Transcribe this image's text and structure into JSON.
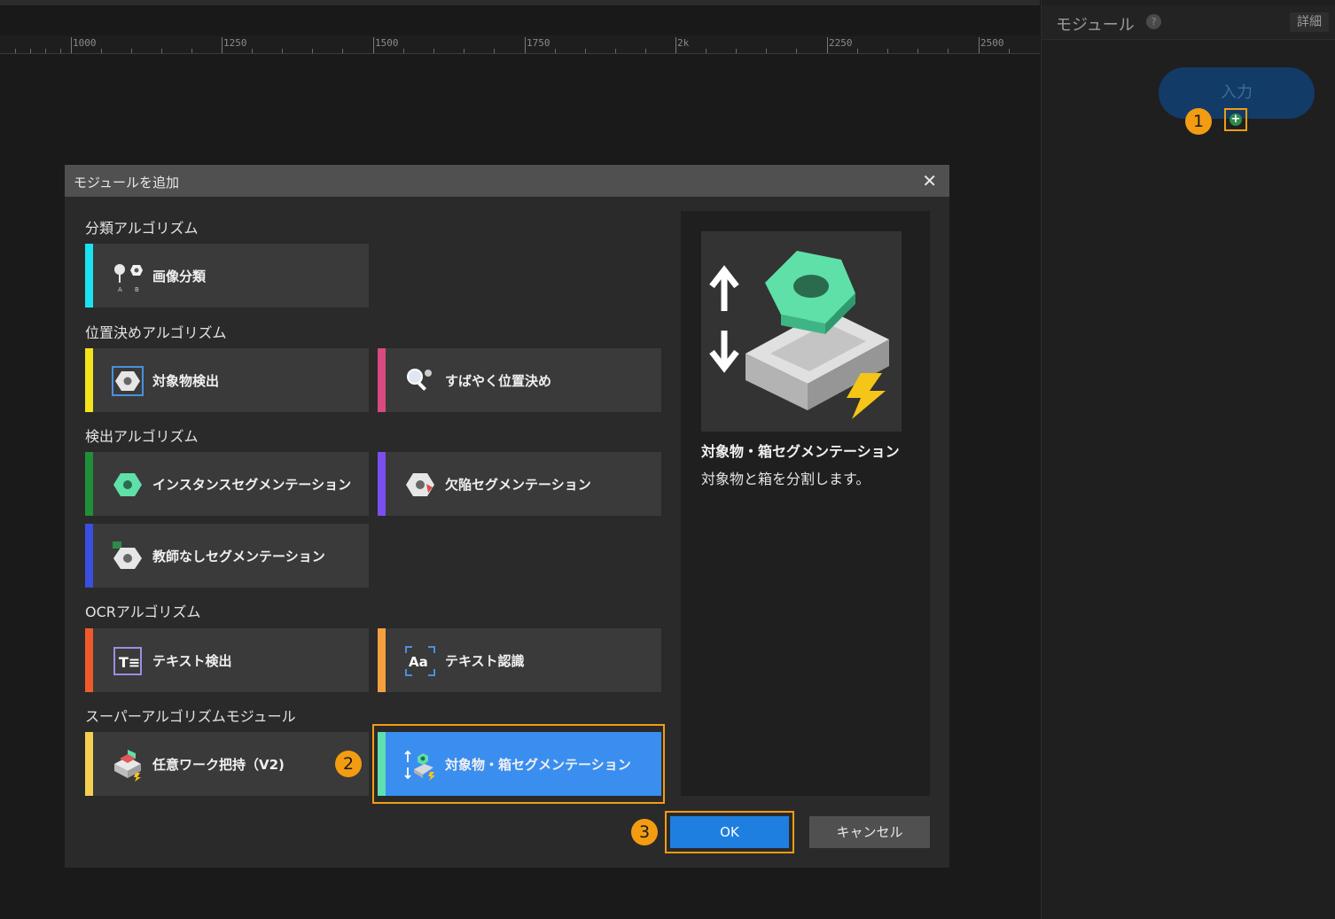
{
  "ruler": {
    "labels": [
      "1000",
      "1250",
      "1500",
      "1750",
      "2k",
      "2250",
      "2500"
    ]
  },
  "right_panel": {
    "title": "モジュール",
    "help_symbol": "?",
    "detail_label": "詳細",
    "input_node_label": "入力",
    "plus_symbol": "+"
  },
  "steps": [
    "1",
    "2",
    "3"
  ],
  "dialog": {
    "title": "モジュールを追加",
    "close_symbol": "✕",
    "sections": [
      {
        "title": "分類アルゴリズム",
        "cards": [
          {
            "label": "画像分類",
            "accent": "#19e3f0"
          }
        ]
      },
      {
        "title": "位置決めアルゴリズム",
        "cards": [
          {
            "label": "対象物検出",
            "accent": "#f5e31b"
          },
          {
            "label": "すばやく位置決め",
            "accent": "#d94a82"
          }
        ]
      },
      {
        "title": "検出アルゴリズム",
        "cards": [
          {
            "label": "インスタンスセグメンテーション",
            "accent": "#1f8f3a"
          },
          {
            "label": "欠陥セグメンテーション",
            "accent": "#7b4ef0"
          },
          {
            "label": "教師なしセグメンテーション",
            "accent": "#3a4ee0"
          }
        ]
      },
      {
        "title": "OCRアルゴリズム",
        "cards": [
          {
            "label": "テキスト検出",
            "accent": "#f05a2a"
          },
          {
            "label": "テキスト認識",
            "accent": "#f5a040"
          }
        ]
      },
      {
        "title": "スーパーアルゴリズムモジュール",
        "cards": [
          {
            "label": "任意ワーク把持（V2)",
            "accent": "#f5d050"
          },
          {
            "label": "対象物・箱セグメンテーション",
            "accent": "#5ee0b0"
          }
        ]
      }
    ],
    "preview": {
      "name": "対象物・箱セグメンテーション",
      "description": "対象物と箱を分割します。"
    },
    "ok_label": "OK",
    "cancel_label": "キャンセル"
  },
  "colors": {
    "highlight": "#f39c12",
    "selected_card": "#3a8ef0",
    "ok_button": "#1f7fe0",
    "hex_green": "#5fe0a8"
  }
}
